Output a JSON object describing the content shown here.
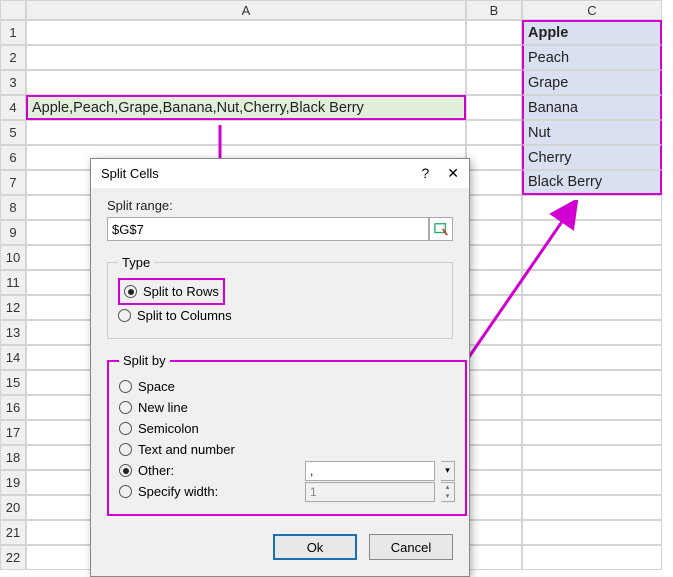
{
  "columns": {
    "A": "A",
    "B": "B",
    "C": "C"
  },
  "cellA4": "Apple,Peach,Grape,Banana,Nut,Cherry,Black Berry",
  "resultC": [
    "Apple",
    "Peach",
    "Grape",
    "Banana",
    "Nut",
    "Cherry",
    "Black Berry"
  ],
  "dialog": {
    "title": "Split Cells",
    "help": "?",
    "close": "✕",
    "split_range_label": "Split range:",
    "split_range_value": "$G$7",
    "type_legend": "Type",
    "type_rows": "Split to Rows",
    "type_cols": "Split to Columns",
    "splitby_legend": "Split by",
    "opt_space": "Space",
    "opt_newline": "New line",
    "opt_semi": "Semicolon",
    "opt_textnum": "Text and number",
    "opt_other": "Other:",
    "opt_width": "Specify width:",
    "other_value": ",",
    "width_value": "1",
    "ok": "Ok",
    "cancel": "Cancel"
  }
}
